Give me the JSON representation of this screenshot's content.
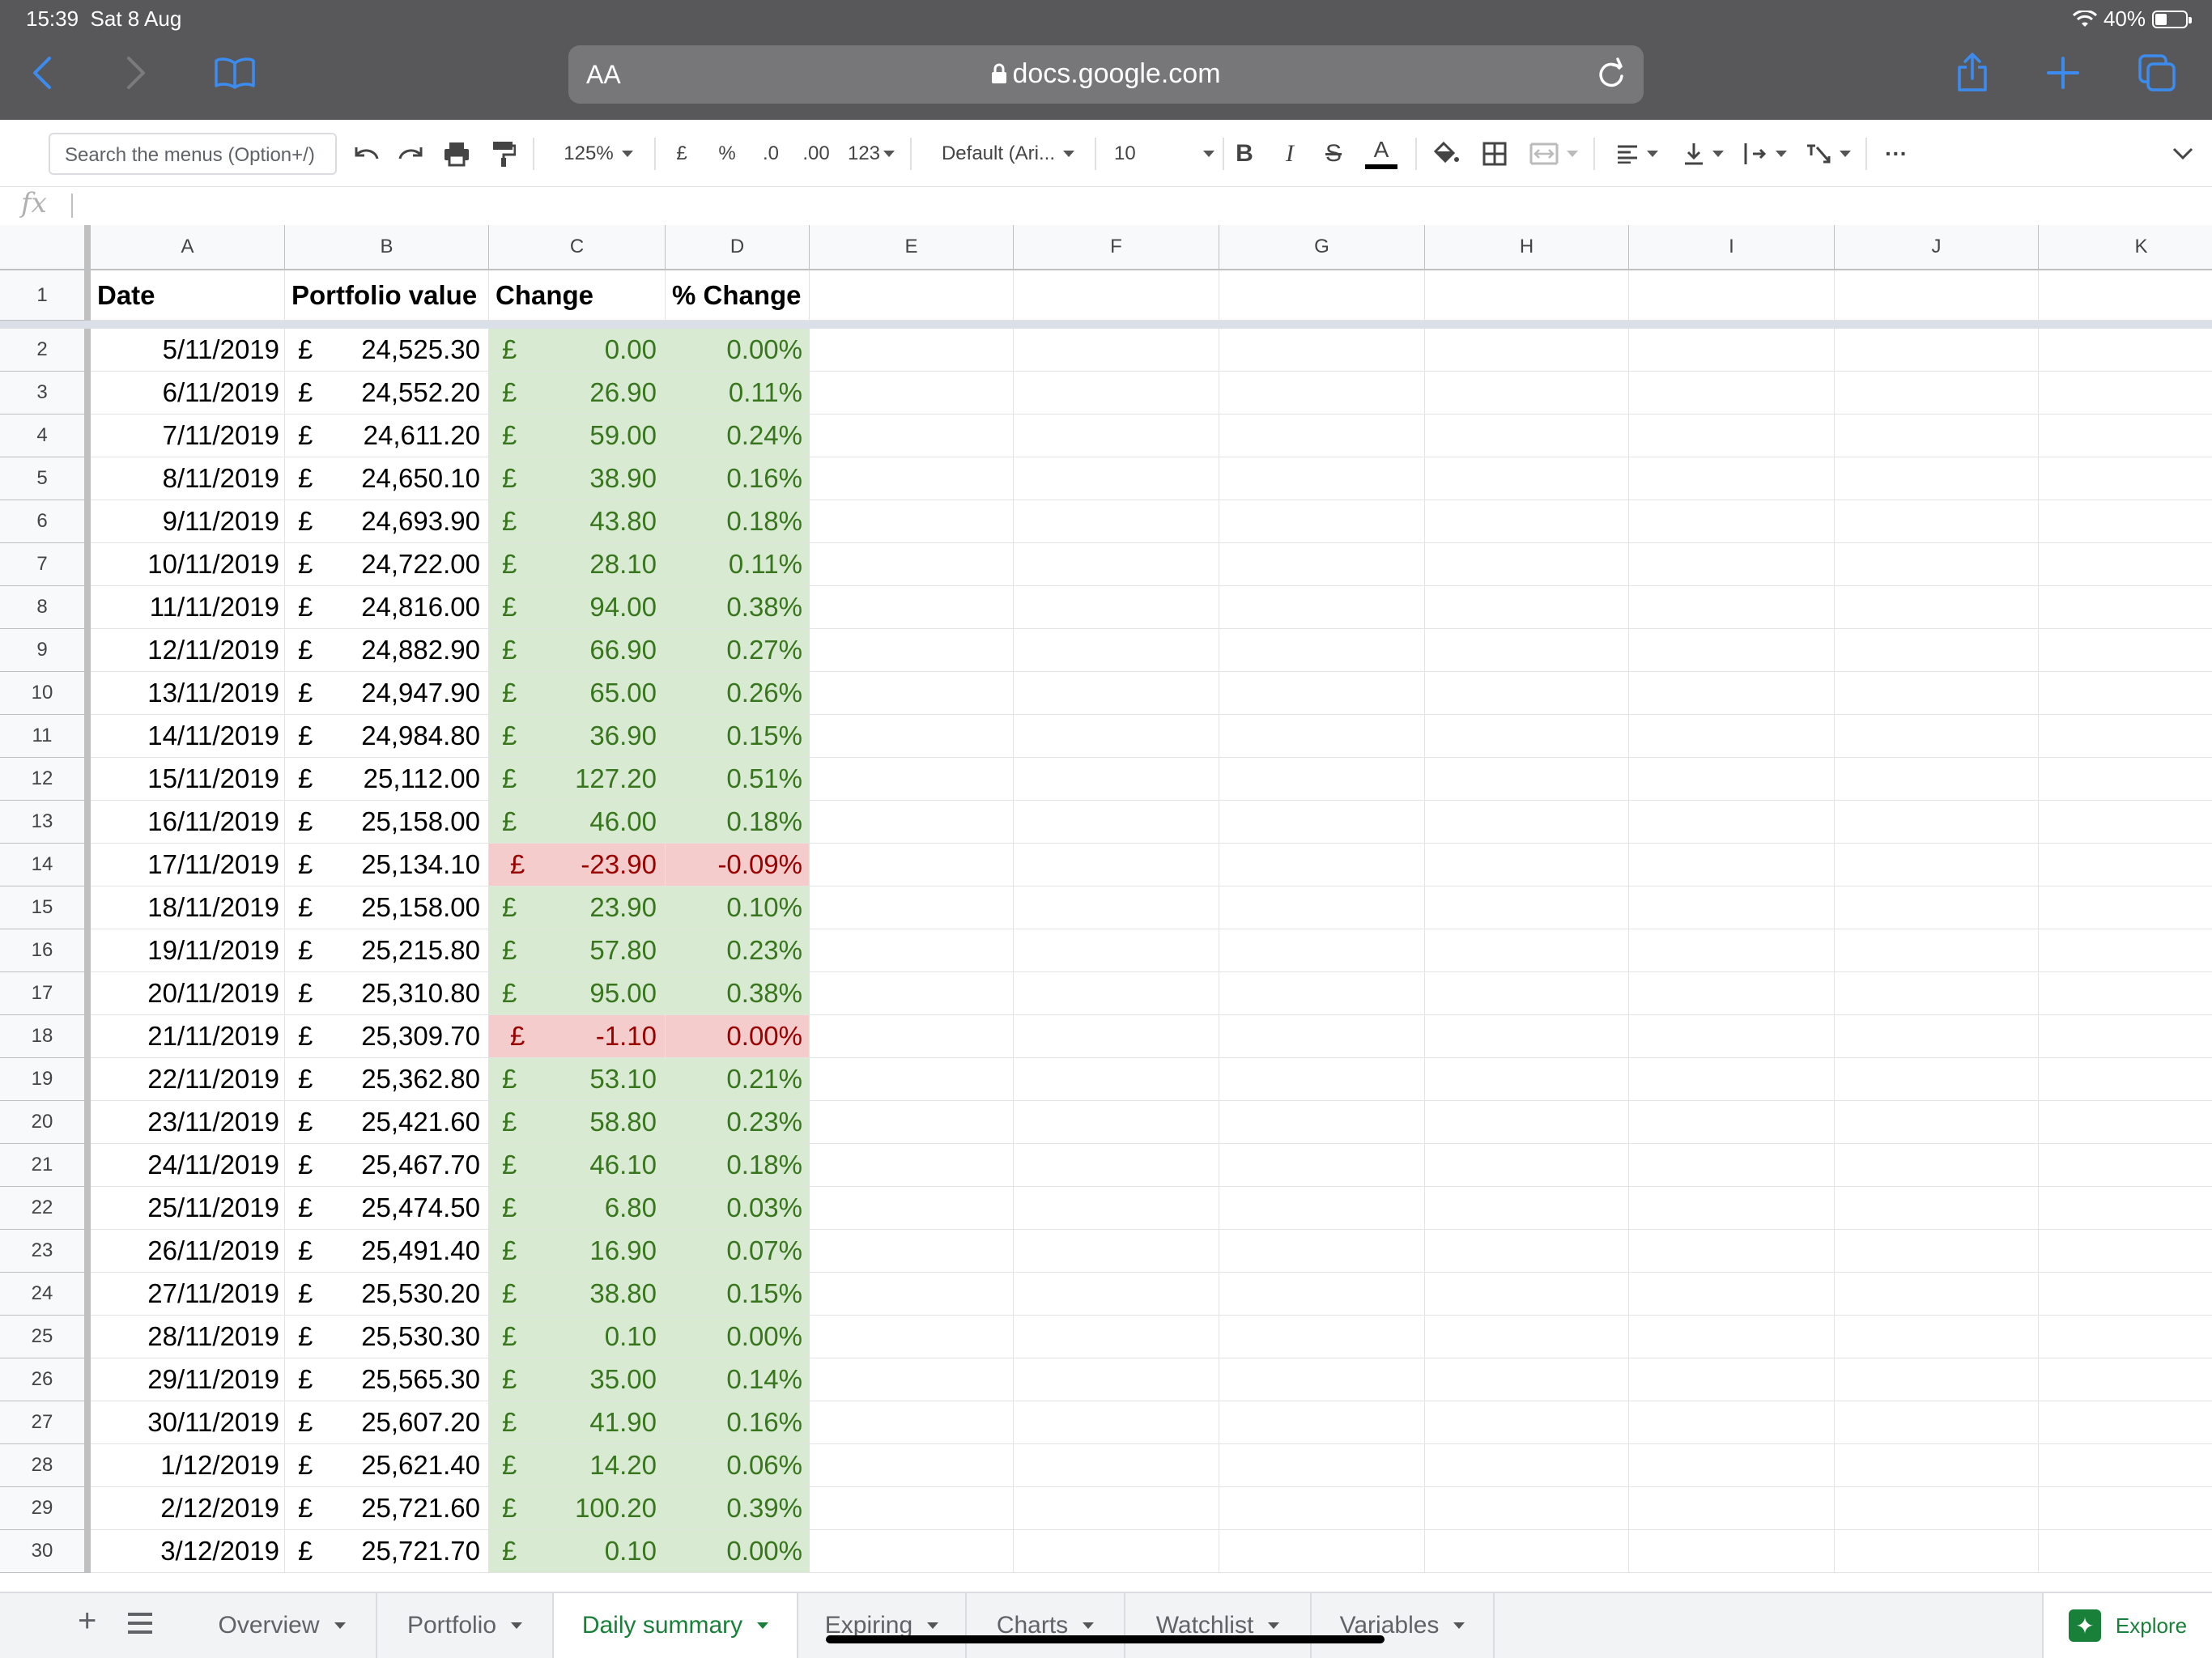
{
  "status": {
    "time": "15:39",
    "date": "Sat 8 Aug",
    "battery": "40%",
    "battery_level": 0.4
  },
  "browser": {
    "text_size_label": "AA",
    "url": "docs.google.com"
  },
  "toolbar": {
    "search_placeholder": "Search the menus (Option+/)",
    "zoom": "125%",
    "currency": "£",
    "percent": "%",
    "decimal_decrease": ".0",
    "decimal_increase": ".00",
    "format_more": "123",
    "font": "Default (Ari...",
    "font_size": "10",
    "bold": "B",
    "italic": "I",
    "strike": "S",
    "text_color": "A",
    "more": "···"
  },
  "formula_bar": {
    "fx": "fx",
    "value": ""
  },
  "columns": [
    "A",
    "B",
    "C",
    "D",
    "E",
    "F",
    "G",
    "H",
    "I",
    "J",
    "K"
  ],
  "headers": {
    "date": "Date",
    "portfolio_value": "Portfolio value",
    "change": "Change",
    "pct_change": "% Change"
  },
  "currency_symbol": "£",
  "rows": [
    {
      "n": "2",
      "date": "5/11/2019",
      "value": "24,525.30",
      "change": "0.00",
      "pct": "0.00%",
      "dir": "pos"
    },
    {
      "n": "3",
      "date": "6/11/2019",
      "value": "24,552.20",
      "change": "26.90",
      "pct": "0.11%",
      "dir": "pos"
    },
    {
      "n": "4",
      "date": "7/11/2019",
      "value": "24,611.20",
      "change": "59.00",
      "pct": "0.24%",
      "dir": "pos"
    },
    {
      "n": "5",
      "date": "8/11/2019",
      "value": "24,650.10",
      "change": "38.90",
      "pct": "0.16%",
      "dir": "pos"
    },
    {
      "n": "6",
      "date": "9/11/2019",
      "value": "24,693.90",
      "change": "43.80",
      "pct": "0.18%",
      "dir": "pos"
    },
    {
      "n": "7",
      "date": "10/11/2019",
      "value": "24,722.00",
      "change": "28.10",
      "pct": "0.11%",
      "dir": "pos"
    },
    {
      "n": "8",
      "date": "11/11/2019",
      "value": "24,816.00",
      "change": "94.00",
      "pct": "0.38%",
      "dir": "pos"
    },
    {
      "n": "9",
      "date": "12/11/2019",
      "value": "24,882.90",
      "change": "66.90",
      "pct": "0.27%",
      "dir": "pos"
    },
    {
      "n": "10",
      "date": "13/11/2019",
      "value": "24,947.90",
      "change": "65.00",
      "pct": "0.26%",
      "dir": "pos"
    },
    {
      "n": "11",
      "date": "14/11/2019",
      "value": "24,984.80",
      "change": "36.90",
      "pct": "0.15%",
      "dir": "pos"
    },
    {
      "n": "12",
      "date": "15/11/2019",
      "value": "25,112.00",
      "change": "127.20",
      "pct": "0.51%",
      "dir": "pos"
    },
    {
      "n": "13",
      "date": "16/11/2019",
      "value": "25,158.00",
      "change": "46.00",
      "pct": "0.18%",
      "dir": "pos"
    },
    {
      "n": "14",
      "date": "17/11/2019",
      "value": "25,134.10",
      "change": "-23.90",
      "pct": "-0.09%",
      "dir": "neg"
    },
    {
      "n": "15",
      "date": "18/11/2019",
      "value": "25,158.00",
      "change": "23.90",
      "pct": "0.10%",
      "dir": "pos"
    },
    {
      "n": "16",
      "date": "19/11/2019",
      "value": "25,215.80",
      "change": "57.80",
      "pct": "0.23%",
      "dir": "pos"
    },
    {
      "n": "17",
      "date": "20/11/2019",
      "value": "25,310.80",
      "change": "95.00",
      "pct": "0.38%",
      "dir": "pos"
    },
    {
      "n": "18",
      "date": "21/11/2019",
      "value": "25,309.70",
      "change": "-1.10",
      "pct": "0.00%",
      "dir": "neg"
    },
    {
      "n": "19",
      "date": "22/11/2019",
      "value": "25,362.80",
      "change": "53.10",
      "pct": "0.21%",
      "dir": "pos"
    },
    {
      "n": "20",
      "date": "23/11/2019",
      "value": "25,421.60",
      "change": "58.80",
      "pct": "0.23%",
      "dir": "pos"
    },
    {
      "n": "21",
      "date": "24/11/2019",
      "value": "25,467.70",
      "change": "46.10",
      "pct": "0.18%",
      "dir": "pos"
    },
    {
      "n": "22",
      "date": "25/11/2019",
      "value": "25,474.50",
      "change": "6.80",
      "pct": "0.03%",
      "dir": "pos"
    },
    {
      "n": "23",
      "date": "26/11/2019",
      "value": "25,491.40",
      "change": "16.90",
      "pct": "0.07%",
      "dir": "pos"
    },
    {
      "n": "24",
      "date": "27/11/2019",
      "value": "25,530.20",
      "change": "38.80",
      "pct": "0.15%",
      "dir": "pos"
    },
    {
      "n": "25",
      "date": "28/11/2019",
      "value": "25,530.30",
      "change": "0.10",
      "pct": "0.00%",
      "dir": "pos"
    },
    {
      "n": "26",
      "date": "29/11/2019",
      "value": "25,565.30",
      "change": "35.00",
      "pct": "0.14%",
      "dir": "pos"
    },
    {
      "n": "27",
      "date": "30/11/2019",
      "value": "25,607.20",
      "change": "41.90",
      "pct": "0.16%",
      "dir": "pos"
    },
    {
      "n": "28",
      "date": "1/12/2019",
      "value": "25,621.40",
      "change": "14.20",
      "pct": "0.06%",
      "dir": "pos"
    },
    {
      "n": "29",
      "date": "2/12/2019",
      "value": "25,721.60",
      "change": "100.20",
      "pct": "0.39%",
      "dir": "pos"
    },
    {
      "n": "30",
      "date": "3/12/2019",
      "value": "25,721.70",
      "change": "0.10",
      "pct": "0.00%",
      "dir": "pos"
    }
  ],
  "sheet_tabs": [
    {
      "label": "Overview",
      "active": false
    },
    {
      "label": "Portfolio",
      "active": false
    },
    {
      "label": "Daily summary",
      "active": true
    },
    {
      "label": "Expiring",
      "active": false
    },
    {
      "label": "Charts",
      "active": false
    },
    {
      "label": "Watchlist",
      "active": false
    },
    {
      "label": "Variables",
      "active": false
    }
  ],
  "explore_label": "Explore",
  "colors": {
    "positive_bg": "#d9ead3",
    "positive_text": "#38761d",
    "negative_bg": "#f4cccc",
    "negative_text": "#990000",
    "accent": "#188038",
    "safari_blue": "#3c8cf0"
  }
}
